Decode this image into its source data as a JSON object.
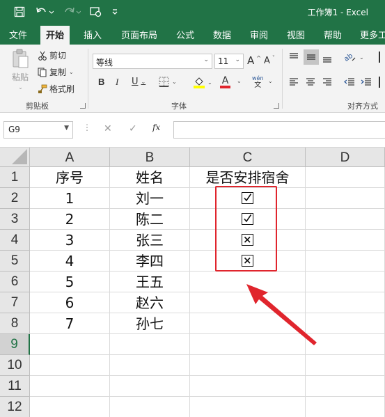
{
  "title_bar": {
    "doc_title": "工作簿1  -  Excel",
    "quick_access": [
      "save-icon",
      "undo-icon",
      "redo-icon",
      "touch-mode-icon",
      "customize-icon"
    ]
  },
  "tabs": [
    "文件",
    "开始",
    "插入",
    "页面布局",
    "公式",
    "数据",
    "审阅",
    "视图",
    "帮助",
    "更多工"
  ],
  "active_tab": "开始",
  "ribbon": {
    "clipboard": {
      "paste_label": "粘贴",
      "cut_label": "剪切",
      "copy_label": "复制",
      "format_painter_label": "格式刷",
      "group_label": "剪贴板"
    },
    "font": {
      "font_name": "等线",
      "font_size": "11",
      "grow_label": "A",
      "shrink_label": "A",
      "bold_label": "B",
      "italic_label": "I",
      "underline_label": "U",
      "font_color_label": "A",
      "pinyin_top": "wén",
      "pinyin_bottom": "文",
      "group_label": "字体",
      "fill_color": "#ffff00",
      "font_color": "#e0252d"
    },
    "alignment": {
      "group_label": "对齐方式"
    }
  },
  "formula_bar": {
    "name_box": "G9",
    "cancel_symbol": "✕",
    "enter_symbol": "✓",
    "fx_label": "fx",
    "formula": ""
  },
  "sheet": {
    "columns": [
      "A",
      "B",
      "C",
      "D"
    ],
    "rows": [
      "1",
      "2",
      "3",
      "4",
      "5",
      "6",
      "7",
      "8",
      "9",
      "10",
      "11",
      "12"
    ],
    "active_row": "9",
    "header": [
      "序号",
      "姓名",
      "是否安排宿舍"
    ],
    "data": [
      {
        "no": "1",
        "name": "刘一",
        "status": "checked"
      },
      {
        "no": "2",
        "name": "陈二",
        "status": "checked"
      },
      {
        "no": "3",
        "name": "张三",
        "status": "crossed"
      },
      {
        "no": "4",
        "name": "李四",
        "status": "crossed"
      },
      {
        "no": "5",
        "name": "王五",
        "status": ""
      },
      {
        "no": "6",
        "name": "赵六",
        "status": ""
      },
      {
        "no": "7",
        "name": "孙七",
        "status": ""
      }
    ]
  },
  "colors": {
    "excel_green": "#217346",
    "annotation_red": "#e0252d"
  }
}
